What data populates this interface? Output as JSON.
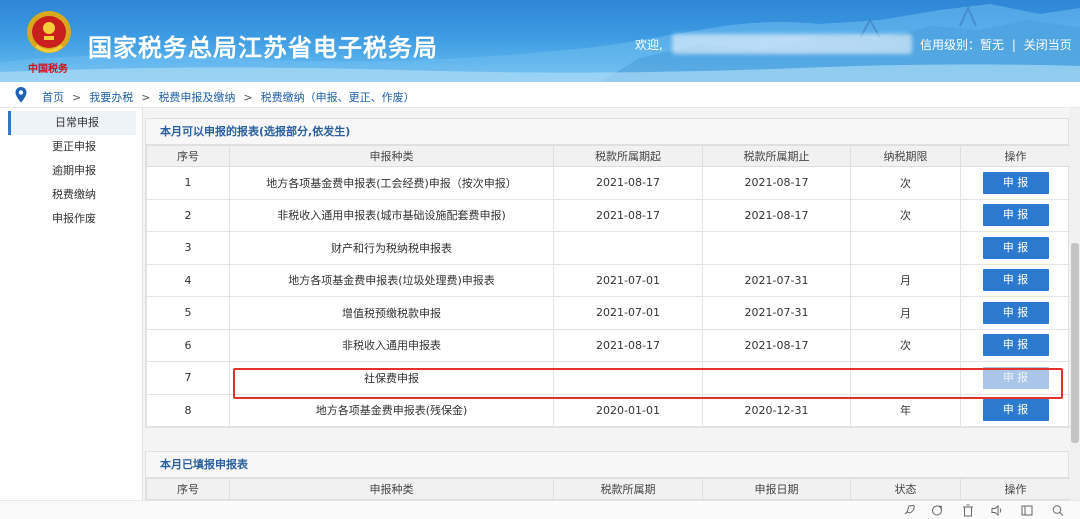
{
  "header": {
    "site_title": "国家税务总局江苏省电子税务局",
    "emblem_caption": "中国税务",
    "welcome": "欢迎,",
    "credit_label": "信用级别：暂无",
    "close_label": "关闭当页"
  },
  "breadcrumb": [
    "首页",
    "我要办税",
    "税费申报及缴纳",
    "税费缴纳（申报、更正、作废）"
  ],
  "sidebar": {
    "items": [
      {
        "label": "日常申报",
        "active": true
      },
      {
        "label": "更正申报",
        "active": false
      },
      {
        "label": "逾期申报",
        "active": false
      },
      {
        "label": "税费缴纳",
        "active": false
      },
      {
        "label": "申报作废",
        "active": false
      }
    ]
  },
  "section1": {
    "title": "本月可以申报的报表(选报部分,依发生)",
    "headers": [
      "序号",
      "申报种类",
      "税款所属期起",
      "税款所属期止",
      "纳税期限",
      "操作"
    ],
    "rows": [
      {
        "no": "1",
        "type": "地方各项基金费申报表(工会经费)申报（按次申报）",
        "start": "2021-08-17",
        "end": "2021-08-17",
        "period": "次",
        "action": "申 报",
        "disabled": false
      },
      {
        "no": "2",
        "type": "非税收入通用申报表(城市基础设施配套费申报)",
        "start": "2021-08-17",
        "end": "2021-08-17",
        "period": "次",
        "action": "申 报",
        "disabled": false
      },
      {
        "no": "3",
        "type": "财产和行为税纳税申报表",
        "start": "",
        "end": "",
        "period": "",
        "action": "申 报",
        "disabled": false
      },
      {
        "no": "4",
        "type": "地方各项基金费申报表(垃圾处理费)申报表",
        "start": "2021-07-01",
        "end": "2021-07-31",
        "period": "月",
        "action": "申 报",
        "disabled": false
      },
      {
        "no": "5",
        "type": "增值税预缴税款申报",
        "start": "2021-07-01",
        "end": "2021-07-31",
        "period": "月",
        "action": "申 报",
        "disabled": false
      },
      {
        "no": "6",
        "type": "非税收入通用申报表",
        "start": "2021-08-17",
        "end": "2021-08-17",
        "period": "次",
        "action": "申 报",
        "disabled": false
      },
      {
        "no": "7",
        "type": "社保费申报",
        "start": "",
        "end": "",
        "period": "",
        "action": "申 报",
        "disabled": true
      },
      {
        "no": "8",
        "type": "地方各项基金费申报表(残保金)",
        "start": "2020-01-01",
        "end": "2020-12-31",
        "period": "年",
        "action": "申 报",
        "disabled": false
      }
    ]
  },
  "section2": {
    "title": "本月已填报申报表",
    "headers": [
      "序号",
      "申报种类",
      "税款所属期",
      "申报日期",
      "状态",
      "操作"
    ]
  },
  "colors": {
    "accent": "#2b7ad0",
    "highlight": "#e5312b",
    "header_blue": "#2e86d6"
  },
  "toolbar_icons": [
    "rocket-icon",
    "refresh-icon",
    "trash-icon",
    "speaker-icon",
    "window-icon",
    "search-icon"
  ]
}
